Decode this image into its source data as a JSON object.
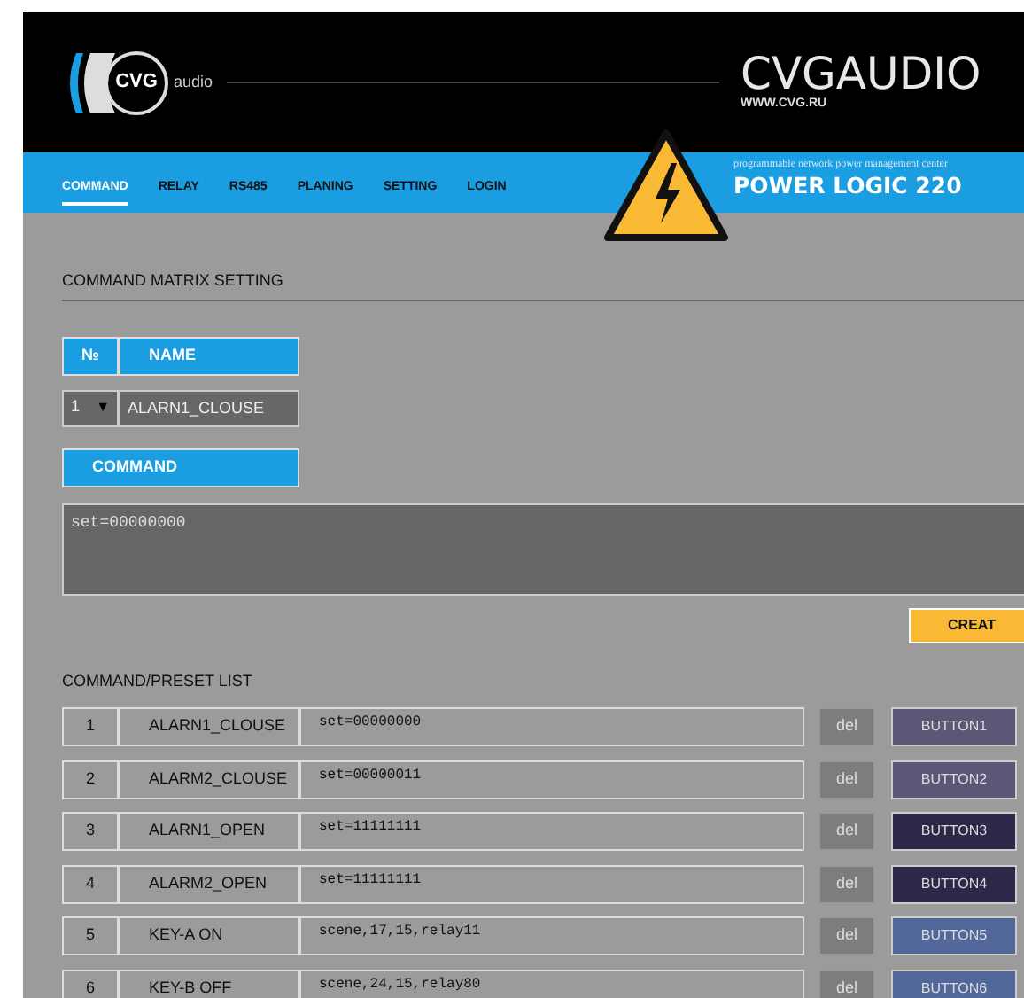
{
  "header": {
    "logo_mark": "CVG",
    "logo_word": "audio",
    "brand": "CVGAUDIO",
    "site": "WWW.CVG.RU",
    "tagline": "programmable network power management center",
    "product": "POWER LOGIC 220"
  },
  "tabs": [
    {
      "label": "COMMAND",
      "selected": true
    },
    {
      "label": "RELAY",
      "selected": false
    },
    {
      "label": "RS485",
      "selected": false
    },
    {
      "label": "PLANING",
      "selected": false
    },
    {
      "label": "SETTING",
      "selected": false
    },
    {
      "label": "LOGIN",
      "selected": false
    }
  ],
  "matrix": {
    "title": "COMMAND MATRIX SETTING",
    "number_heading": "№",
    "name_heading": "NAME",
    "number_value": "1",
    "number_caret": "▼",
    "name_value": "ALARN1_CLOUSE",
    "command_heading": "COMMAND",
    "command_value": "set=00000000",
    "create_button": "CREAT"
  },
  "list": {
    "title": "COMMAND/PRESET LIST",
    "rows": [
      {
        "number": "1",
        "name": "ALARN1_CLOUSE",
        "command": "set=00000000",
        "delete": "del",
        "button": "BUTTON1",
        "color": "#5e5677"
      },
      {
        "number": "2",
        "name": "ALARM2_CLOUSE",
        "command": "set=00000011",
        "delete": "del",
        "button": "BUTTON2",
        "color": "#5e5677"
      },
      {
        "number": "3",
        "name": "ALARN1_OPEN",
        "command": "set=11111111",
        "delete": "del",
        "button": "BUTTON3",
        "color": "#2e2848"
      },
      {
        "number": "4",
        "name": "ALARM2_OPEN",
        "command": "set=11111111",
        "delete": "del",
        "button": "BUTTON4",
        "color": "#2e2848"
      },
      {
        "number": "5",
        "name": "KEY-A ON",
        "command": "scene,17,15,relay11",
        "delete": "del",
        "button": "BUTTON5",
        "color": "#53689a"
      },
      {
        "number": "6",
        "name": "KEY-B OFF",
        "command": "scene,24,15,relay80",
        "delete": "del",
        "button": "BUTTON6",
        "color": "#53689a"
      }
    ]
  }
}
